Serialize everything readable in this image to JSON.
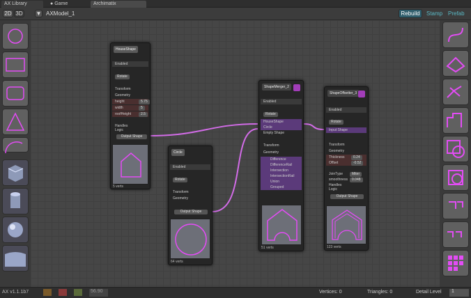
{
  "tabs": {
    "t1": "AX Library",
    "t2": "Game",
    "t3": "Archimatix"
  },
  "toolbar": {
    "b2d": "2D",
    "b3d": "3D",
    "title": "AXModel_1",
    "rebuild": "Rebuild",
    "stamp": "Stamp",
    "prefab": "Prefab"
  },
  "left_tools": [
    "circle-icon",
    "rectangle-icon",
    "rounded-rect-icon",
    "triangle-icon",
    "arc-icon",
    "cube-icon",
    "cylinder-icon",
    "sphere-icon",
    "plane-icon"
  ],
  "right_tools": [
    "shape-curve-icon",
    "shape-offset-icon",
    "shape-distributor-icon",
    "shape-stairs-icon",
    "shape-merge-icon",
    "shape-offset-outline-icon",
    "corner-icon",
    "corner-pair-icon",
    "grid-repeater-icon"
  ],
  "nodes": {
    "n1": {
      "title": "HouseShape",
      "enabled": "Enabled",
      "rotate": "Rotate",
      "transform": "Transform",
      "geometry": "Geometry",
      "p1l": "height",
      "p1v": "5.75",
      "p2l": "width",
      "p2v": "5",
      "p3l": "roofHeight",
      "p3v": "2.5",
      "handles": "Handles",
      "logic": "Logic",
      "out": "Output Shape",
      "verts": "5 verts"
    },
    "n2": {
      "title": "Circle",
      "enabled": "Enabled",
      "rotate": "Rotate",
      "transform": "Transform",
      "geometry": "Geometry",
      "out": "Output Shape",
      "verts": "64 verts"
    },
    "n3": {
      "title": "ShapeMerger_2",
      "enabled": "Enabled",
      "rotate": "Rotate",
      "in1": "HouseShape",
      "in2": "Circle",
      "in3": "Empty Shape",
      "transform": "Transform",
      "geometry": "Geometry",
      "ops": [
        "Difference",
        "DifferenceRail",
        "Intersection",
        "IntersectionRail",
        "Union",
        "Grouped"
      ],
      "verts": "51 verts"
    },
    "n4": {
      "title": "ShapeOffsetter_3",
      "enabled": "Enabled",
      "rotate": "Rotate",
      "in1": "Input Shape",
      "transform": "Transform",
      "geometry": "Geometry",
      "p1l": "Thickness",
      "p1v": "0.24",
      "p2l": "Offset",
      "p2v": "-0.52",
      "p3l": "JoinType",
      "p3v": "Miter",
      "p4l": "smoothness",
      "p4v": "0.048",
      "handles": "Handles",
      "logic": "Logic",
      "out": "Output Shape",
      "verts": "123 verts"
    }
  },
  "status": {
    "version": "AX v1.1.1b7",
    "zoom": "56.90",
    "vertices": "Vertices: 0",
    "triangles": "Triangles: 0",
    "detail_label": "Detail Level",
    "detail_value": "1"
  },
  "colors": {
    "accent": "#e34cf5",
    "wire": "#d36ce8",
    "port": "#b38f00"
  }
}
